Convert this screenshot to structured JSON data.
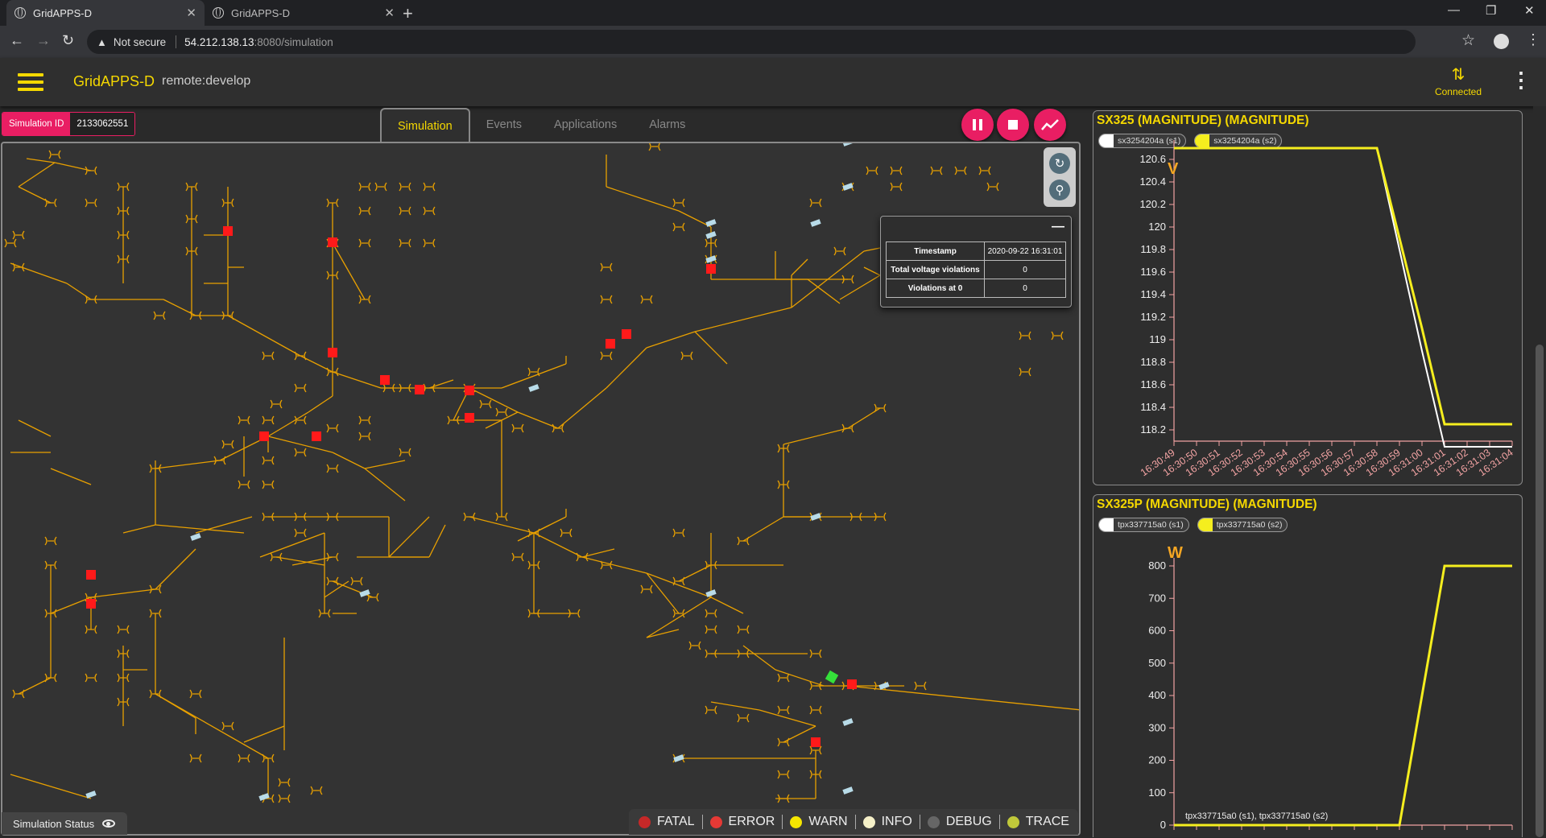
{
  "browser": {
    "tabs": [
      {
        "title": "GridAPPS-D",
        "active": true
      },
      {
        "title": "GridAPPS-D",
        "active": false
      }
    ],
    "address": {
      "security": "Not secure",
      "host": "54.212.138.13",
      "path": ":8080/simulation"
    }
  },
  "header": {
    "title": "GridAPPS-D",
    "subtitle": "remote:develop",
    "status": "Connected"
  },
  "simulation": {
    "id_label": "Simulation ID",
    "id_value": "2133062551",
    "tabs": [
      "Simulation",
      "Events",
      "Applications",
      "Alarms"
    ],
    "active_tab": "Simulation",
    "status_label": "Simulation Status"
  },
  "stats": {
    "rows": [
      {
        "label": "Timestamp",
        "value": "2020-09-22 16:31:01"
      },
      {
        "label": "Total voltage violations",
        "value": "0"
      },
      {
        "label": "Violations at 0",
        "value": "0"
      }
    ]
  },
  "log_levels": [
    {
      "label": "FATAL",
      "color": "#c62828"
    },
    {
      "label": "ERROR",
      "color": "#e53935"
    },
    {
      "label": "WARN",
      "color": "#f5e600"
    },
    {
      "label": "INFO",
      "color": "#f5f0c8"
    },
    {
      "label": "DEBUG",
      "color": "#666666"
    },
    {
      "label": "TRACE",
      "color": "#c0c83a"
    }
  ],
  "colors": {
    "accent": "#f5d800",
    "primary": "#e91e63",
    "line": "#e8a000",
    "violation": "#ff1a1a"
  },
  "chart_data": [
    {
      "type": "line",
      "title": "SX325 (MAGNITUDE) (MAGNITUDE)",
      "ylabel": "V",
      "ylim": [
        118.1,
        120.7
      ],
      "yticks": [
        118.2,
        118.4,
        118.6,
        118.8,
        119,
        119.2,
        119.4,
        119.6,
        119.8,
        120,
        120.2,
        120.4,
        120.6
      ],
      "categories": [
        "16:30:49",
        "16:30:50",
        "16:30:51",
        "16:30:52",
        "16:30:53",
        "16:30:54",
        "16:30:55",
        "16:30:56",
        "16:30:57",
        "16:30:58",
        "16:30:59",
        "16:31:00",
        "16:31:01",
        "16:31:02",
        "16:31:03",
        "16:31:04"
      ],
      "series": [
        {
          "name": "sx3254204a (s1)",
          "color": "#ffffff",
          "values": [
            120.7,
            120.7,
            120.7,
            120.7,
            120.7,
            120.7,
            120.7,
            120.7,
            120.7,
            120.7,
            119.8,
            118.9,
            118.05,
            118.05,
            118.05,
            118.05
          ]
        },
        {
          "name": "sx3254204a (s2)",
          "color": "#f5ee1e",
          "values": [
            120.7,
            120.7,
            120.7,
            120.7,
            120.7,
            120.7,
            120.7,
            120.7,
            120.7,
            120.7,
            119.9,
            119.1,
            118.25,
            118.25,
            118.25,
            118.25
          ]
        }
      ]
    },
    {
      "type": "line",
      "title": "SX325P (MAGNITUDE) (MAGNITUDE)",
      "ylabel": "W",
      "ylim": [
        0,
        800
      ],
      "yticks": [
        0,
        100,
        200,
        300,
        400,
        500,
        600,
        700,
        800
      ],
      "categories": [
        "16:30:49",
        "16:30:50",
        "16:30:51",
        "16:30:52",
        "16:30:53",
        "16:30:54",
        "16:30:55",
        "16:30:56",
        "16:30:57",
        "16:30:58",
        "16:30:59",
        "16:31:00",
        "16:31:01",
        "16:31:02",
        "16:31:03",
        "16:31:04"
      ],
      "series": [
        {
          "name": "tpx337715a0 (s1)",
          "color": "#ffffff",
          "values": [
            0,
            0,
            0,
            0,
            0,
            0,
            0,
            0,
            0,
            0,
            0,
            400,
            800,
            800,
            800,
            800
          ]
        },
        {
          "name": "tpx337715a0 (s2)",
          "color": "#f5ee1e",
          "values": [
            0,
            0,
            0,
            0,
            0,
            0,
            0,
            0,
            0,
            0,
            0,
            400,
            800,
            800,
            800,
            800
          ]
        }
      ],
      "annotation": "tpx337715a0 (s1), tpx337715a0 (s2)"
    }
  ]
}
